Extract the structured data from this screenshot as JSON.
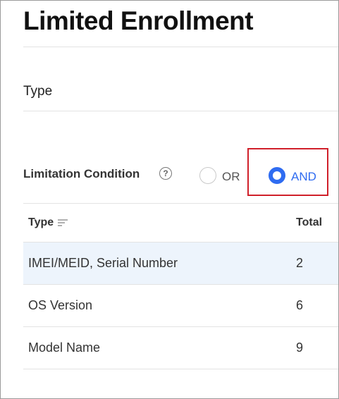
{
  "page": {
    "title": "Limited Enrollment"
  },
  "type_section": {
    "label": "Type"
  },
  "limitation": {
    "label": "Limitation Condition",
    "help_glyph": "?",
    "options": [
      {
        "label": "OR",
        "selected": false
      },
      {
        "label": "AND",
        "selected": true
      }
    ],
    "highlight_color": "#d0202a",
    "accent_color": "#2f6cf1"
  },
  "table": {
    "columns": {
      "type": "Type",
      "total": "Total"
    },
    "rows": [
      {
        "type": "IMEI/MEID, Serial Number",
        "total": "2"
      },
      {
        "type": "OS Version",
        "total": "6"
      },
      {
        "type": "Model Name",
        "total": "9"
      }
    ]
  }
}
